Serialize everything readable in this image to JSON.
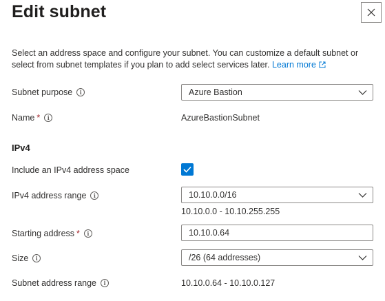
{
  "panel": {
    "title": "Edit subnet",
    "description": "Select an address space and configure your subnet. You can customize a default subnet or select from subnet templates if you plan to add select services later.",
    "learn_more": "Learn more"
  },
  "fields": {
    "subnet_purpose": {
      "label": "Subnet purpose",
      "value": "Azure Bastion"
    },
    "name": {
      "label": "Name",
      "required_mark": "*",
      "value": "AzureBastionSubnet"
    },
    "ipv4_section": "IPv4",
    "include_ipv4": {
      "label": "Include an IPv4 address space",
      "checked": true
    },
    "ipv4_range": {
      "label": "IPv4 address range",
      "value": "10.10.0.0/16",
      "hint": "10.10.0.0 - 10.10.255.255"
    },
    "starting_address": {
      "label": "Starting address",
      "required_mark": "*",
      "value": "10.10.0.64"
    },
    "size": {
      "label": "Size",
      "value": "/26 (64 addresses)"
    },
    "subnet_address_range": {
      "label": "Subnet address range",
      "value": "10.10.0.64 - 10.10.0.127"
    }
  },
  "icons": {
    "info": "info-icon",
    "close": "close-icon",
    "chevron": "chevron-down-icon",
    "external": "external-link-icon",
    "check": "checkmark-icon"
  },
  "colors": {
    "accent": "#0078d4",
    "required": "#a4262c",
    "border": "#8a8886",
    "text": "#323130"
  }
}
